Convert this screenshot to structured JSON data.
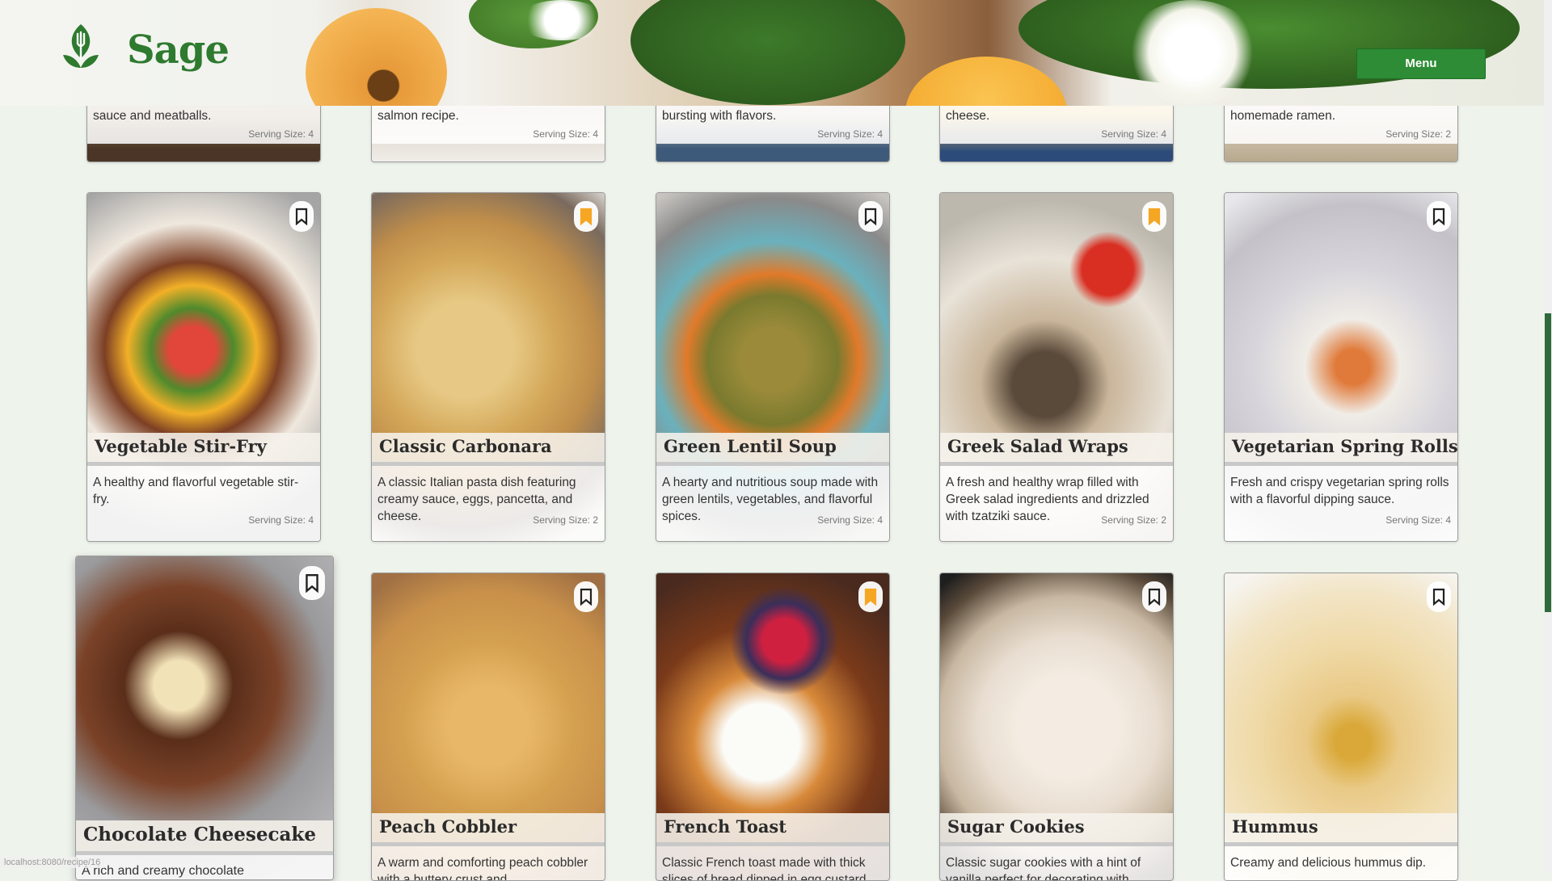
{
  "app": {
    "brand": "Sage",
    "menu_label": "Menu",
    "status_url": "localhost:8080/recipe/16"
  },
  "top_row": [
    {
      "desc": "sauce and meatballs.",
      "serving": "Serving Size: 4",
      "bookmarked": false
    },
    {
      "desc": "salmon recipe.",
      "serving": "Serving Size: 4",
      "bookmarked": false
    },
    {
      "desc": "bursting with flavors.",
      "serving": "Serving Size: 4",
      "bookmarked": false
    },
    {
      "desc": "cheese.",
      "serving": "Serving Size: 4",
      "bookmarked": false
    },
    {
      "desc": "homemade ramen.",
      "serving": "Serving Size: 2",
      "bookmarked": false
    }
  ],
  "middle_row": [
    {
      "title": "Vegetable Stir-Fry",
      "desc": "A healthy and flavorful vegetable stir-fry.",
      "serving": "Serving Size: 4",
      "bookmarked": false
    },
    {
      "title": "Classic Carbonara",
      "desc": "A classic Italian pasta dish featuring creamy sauce, eggs, pancetta, and cheese.",
      "serving": "Serving Size: 2",
      "bookmarked": true
    },
    {
      "title": "Green Lentil Soup",
      "desc": "A hearty and nutritious soup made with green lentils, vegetables, and flavorful spices.",
      "serving": "Serving Size: 4",
      "bookmarked": false
    },
    {
      "title": "Greek Salad Wraps",
      "desc": "A fresh and healthy wrap filled with Greek salad ingredients and drizzled with tzatziki sauce.",
      "serving": "Serving Size: 2",
      "bookmarked": true
    },
    {
      "title": "Vegetarian Spring Rolls",
      "desc": "Fresh and crispy vegetarian spring rolls with a flavorful dipping sauce.",
      "serving": "Serving Size: 4",
      "bookmarked": false
    }
  ],
  "bottom_row": [
    {
      "title": "Chocolate Cheesecake",
      "desc": "A rich and creamy chocolate",
      "bookmarked": false
    },
    {
      "title": "Peach Cobbler",
      "desc": "A warm and comforting peach cobbler with a buttery crust and",
      "bookmarked": false
    },
    {
      "title": "French Toast",
      "desc": "Classic French toast made with thick slices of bread dipped in egg custard",
      "bookmarked": true
    },
    {
      "title": "Sugar Cookies",
      "desc": "Classic sugar cookies with a hint of vanilla perfect for decorating with",
      "bookmarked": false
    },
    {
      "title": "Hummus",
      "desc": "Creamy and delicious hummus dip.",
      "bookmarked": false
    }
  ],
  "colors": {
    "brand_green": "#2e7a2f",
    "menu_green": "#2d8c35",
    "bookmark_active": "#f5a623",
    "bookmark_inactive": "#222222"
  },
  "icons": {
    "logo": "leaf-fork-icon",
    "bookmark": "bookmark-icon"
  }
}
